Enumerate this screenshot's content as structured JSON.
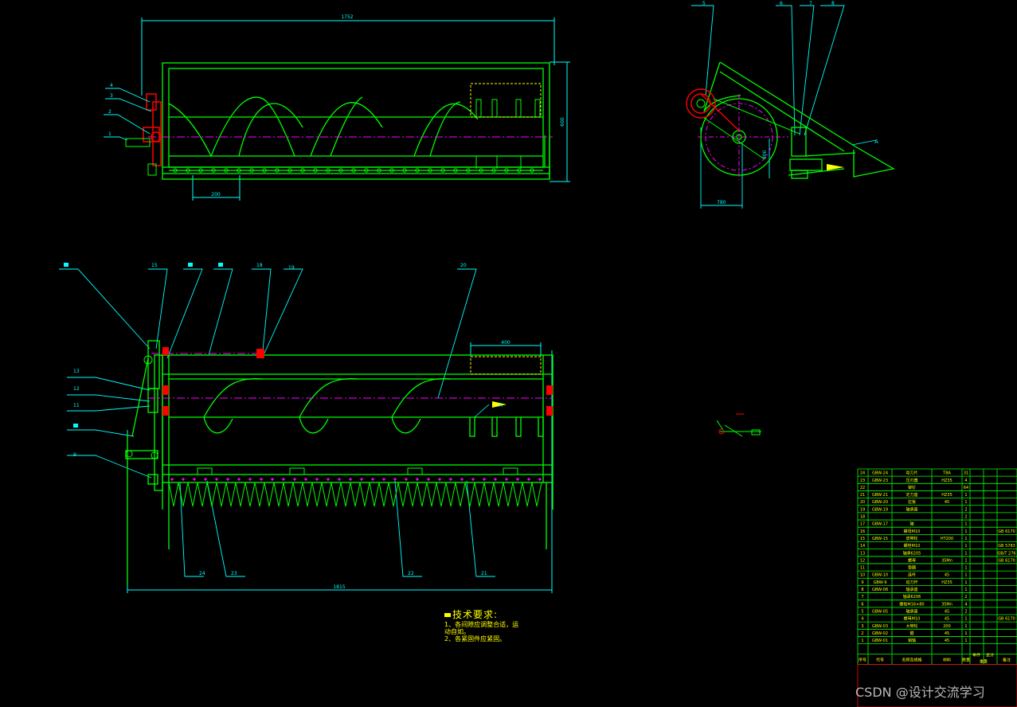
{
  "dimensions": {
    "top_width": "1752",
    "top_height": "600",
    "top_pitch": "200",
    "side_r": "300",
    "side_w": "780",
    "bottom_width": "1815",
    "bottom_box": "400"
  },
  "balloons": {
    "top": [
      "4",
      "3",
      "2",
      "1"
    ],
    "side": [
      "5",
      "6",
      "7",
      "8"
    ],
    "bottom_top": [
      "15",
      "18",
      "19",
      "20"
    ],
    "bottom_left": [
      "13",
      "12",
      "11",
      "9"
    ],
    "bottom_bottom": [
      "24",
      "23",
      "22",
      "21"
    ]
  },
  "section_refs": [
    "A",
    "A",
    "A"
  ],
  "tech_req": {
    "title": "技术要求:",
    "lines": [
      "1、各间隙应调整合适，运",
      "动自如。",
      "2、各紧固件应紧固。"
    ]
  },
  "bom": {
    "rows": [
      [
        "24",
        "GBW-24",
        "动刀片",
        "T8A",
        "31",
        ""
      ],
      [
        "23",
        "GBW-23",
        "压刃器",
        "HZ35",
        "4",
        ""
      ],
      [
        "22",
        "",
        "铆钉",
        "",
        "64",
        ""
      ],
      [
        "21",
        "GBW-21",
        "定刀座",
        "HZ35",
        "1",
        ""
      ],
      [
        "20",
        "GBW-20",
        "拉板",
        "45",
        "1",
        ""
      ],
      [
        "19",
        "GBW-19",
        "轴承座",
        "",
        "2",
        ""
      ],
      [
        "18",
        "",
        "",
        "",
        "2",
        ""
      ],
      [
        "17",
        "GBW-17",
        "轴",
        "",
        "1",
        ""
      ],
      [
        "16",
        "",
        "螺母M10",
        "",
        "1",
        "GB 6170"
      ],
      [
        "15",
        "GBW-15",
        "皮带轮",
        "HT200",
        "1",
        ""
      ],
      [
        "14",
        "",
        "螺栓M10",
        "",
        "1",
        "GB 5783"
      ],
      [
        "13",
        "",
        "轴承6205",
        "",
        "1",
        "GB/T 276"
      ],
      [
        "12",
        "",
        "螺母",
        "35Mn",
        "1",
        "GB 6170"
      ],
      [
        "11",
        "",
        "垫圈",
        "",
        "1",
        ""
      ],
      [
        "10",
        "GBW-10",
        "连杆",
        "45",
        "1",
        ""
      ],
      [
        "9",
        "GBW-9",
        "动刀杆",
        "HZ35",
        "1",
        ""
      ],
      [
        "8",
        "GBW-08",
        "轴承座",
        "",
        "1",
        ""
      ],
      [
        "7",
        "",
        "轴承6206",
        "",
        "2",
        ""
      ],
      [
        "6",
        "",
        "螺栓M16×80",
        "35Mn",
        "4",
        ""
      ],
      [
        "5",
        "GBW-05",
        "轴承座",
        "45",
        "2",
        ""
      ],
      [
        "4",
        "",
        "螺母M10",
        "45",
        "1",
        "GB 6170"
      ],
      [
        "3",
        "GBW-03",
        "大带轮",
        "200",
        "1",
        ""
      ],
      [
        "2",
        "GBW-02",
        "键",
        "45",
        "1",
        ""
      ],
      [
        "1",
        "GBW-01",
        "销轴",
        "45",
        "1",
        ""
      ]
    ],
    "header": [
      "序号",
      "代号",
      "名称及规格",
      "材料",
      "数量",
      "单件",
      "总计",
      "重量",
      "备注"
    ]
  },
  "watermark": "CSDN @设计交流学习",
  "colors": {
    "background": "#000000",
    "outline": "#00ff00",
    "leader": "#00ffff",
    "centerline": "#ff00ff",
    "parts": "#ff0000",
    "hidden": "#ffff00",
    "text": "#ffff00"
  }
}
